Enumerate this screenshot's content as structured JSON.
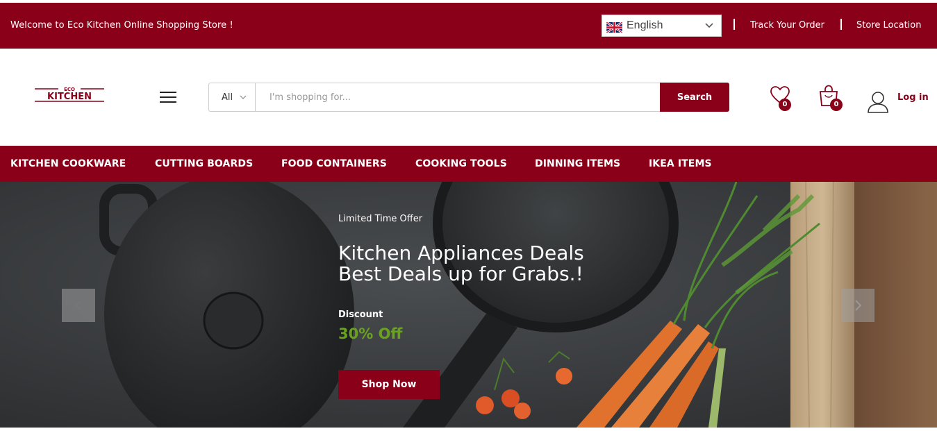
{
  "topbar": {
    "welcome": "Welcome to Eco Kitchen Online Shopping Store !",
    "language": "English",
    "links": [
      "Track Your Order",
      "Store Location"
    ]
  },
  "header": {
    "logo_top": "ECO",
    "logo_main": "KITCHEN",
    "search_category": "All",
    "search_placeholder": "I'm shopping for...",
    "search_button": "Search",
    "wishlist_count": "0",
    "cart_count": "0",
    "login": "Log in"
  },
  "nav": {
    "items": [
      "KITCHEN COOKWARE",
      "CUTTING BOARDS",
      "FOOD CONTAINERS",
      "COOKING TOOLS",
      "DINNING ITEMS",
      "IKEA ITEMS"
    ]
  },
  "hero": {
    "eyebrow": "Limited Time Offer",
    "title_line1": "Kitchen Appliances Deals",
    "title_line2": "Best Deals up for Grabs.!",
    "discount_label": "Discount",
    "discount_value": "30% Off",
    "cta": "Shop Now"
  },
  "colors": {
    "brand": "#8a0019",
    "discount": "#6aa21f"
  },
  "icons": [
    "uk-flag-icon",
    "chevron-down-icon",
    "menu-icon",
    "heart-icon",
    "cart-icon",
    "user-icon",
    "arrow-left-icon",
    "arrow-right-icon"
  ]
}
